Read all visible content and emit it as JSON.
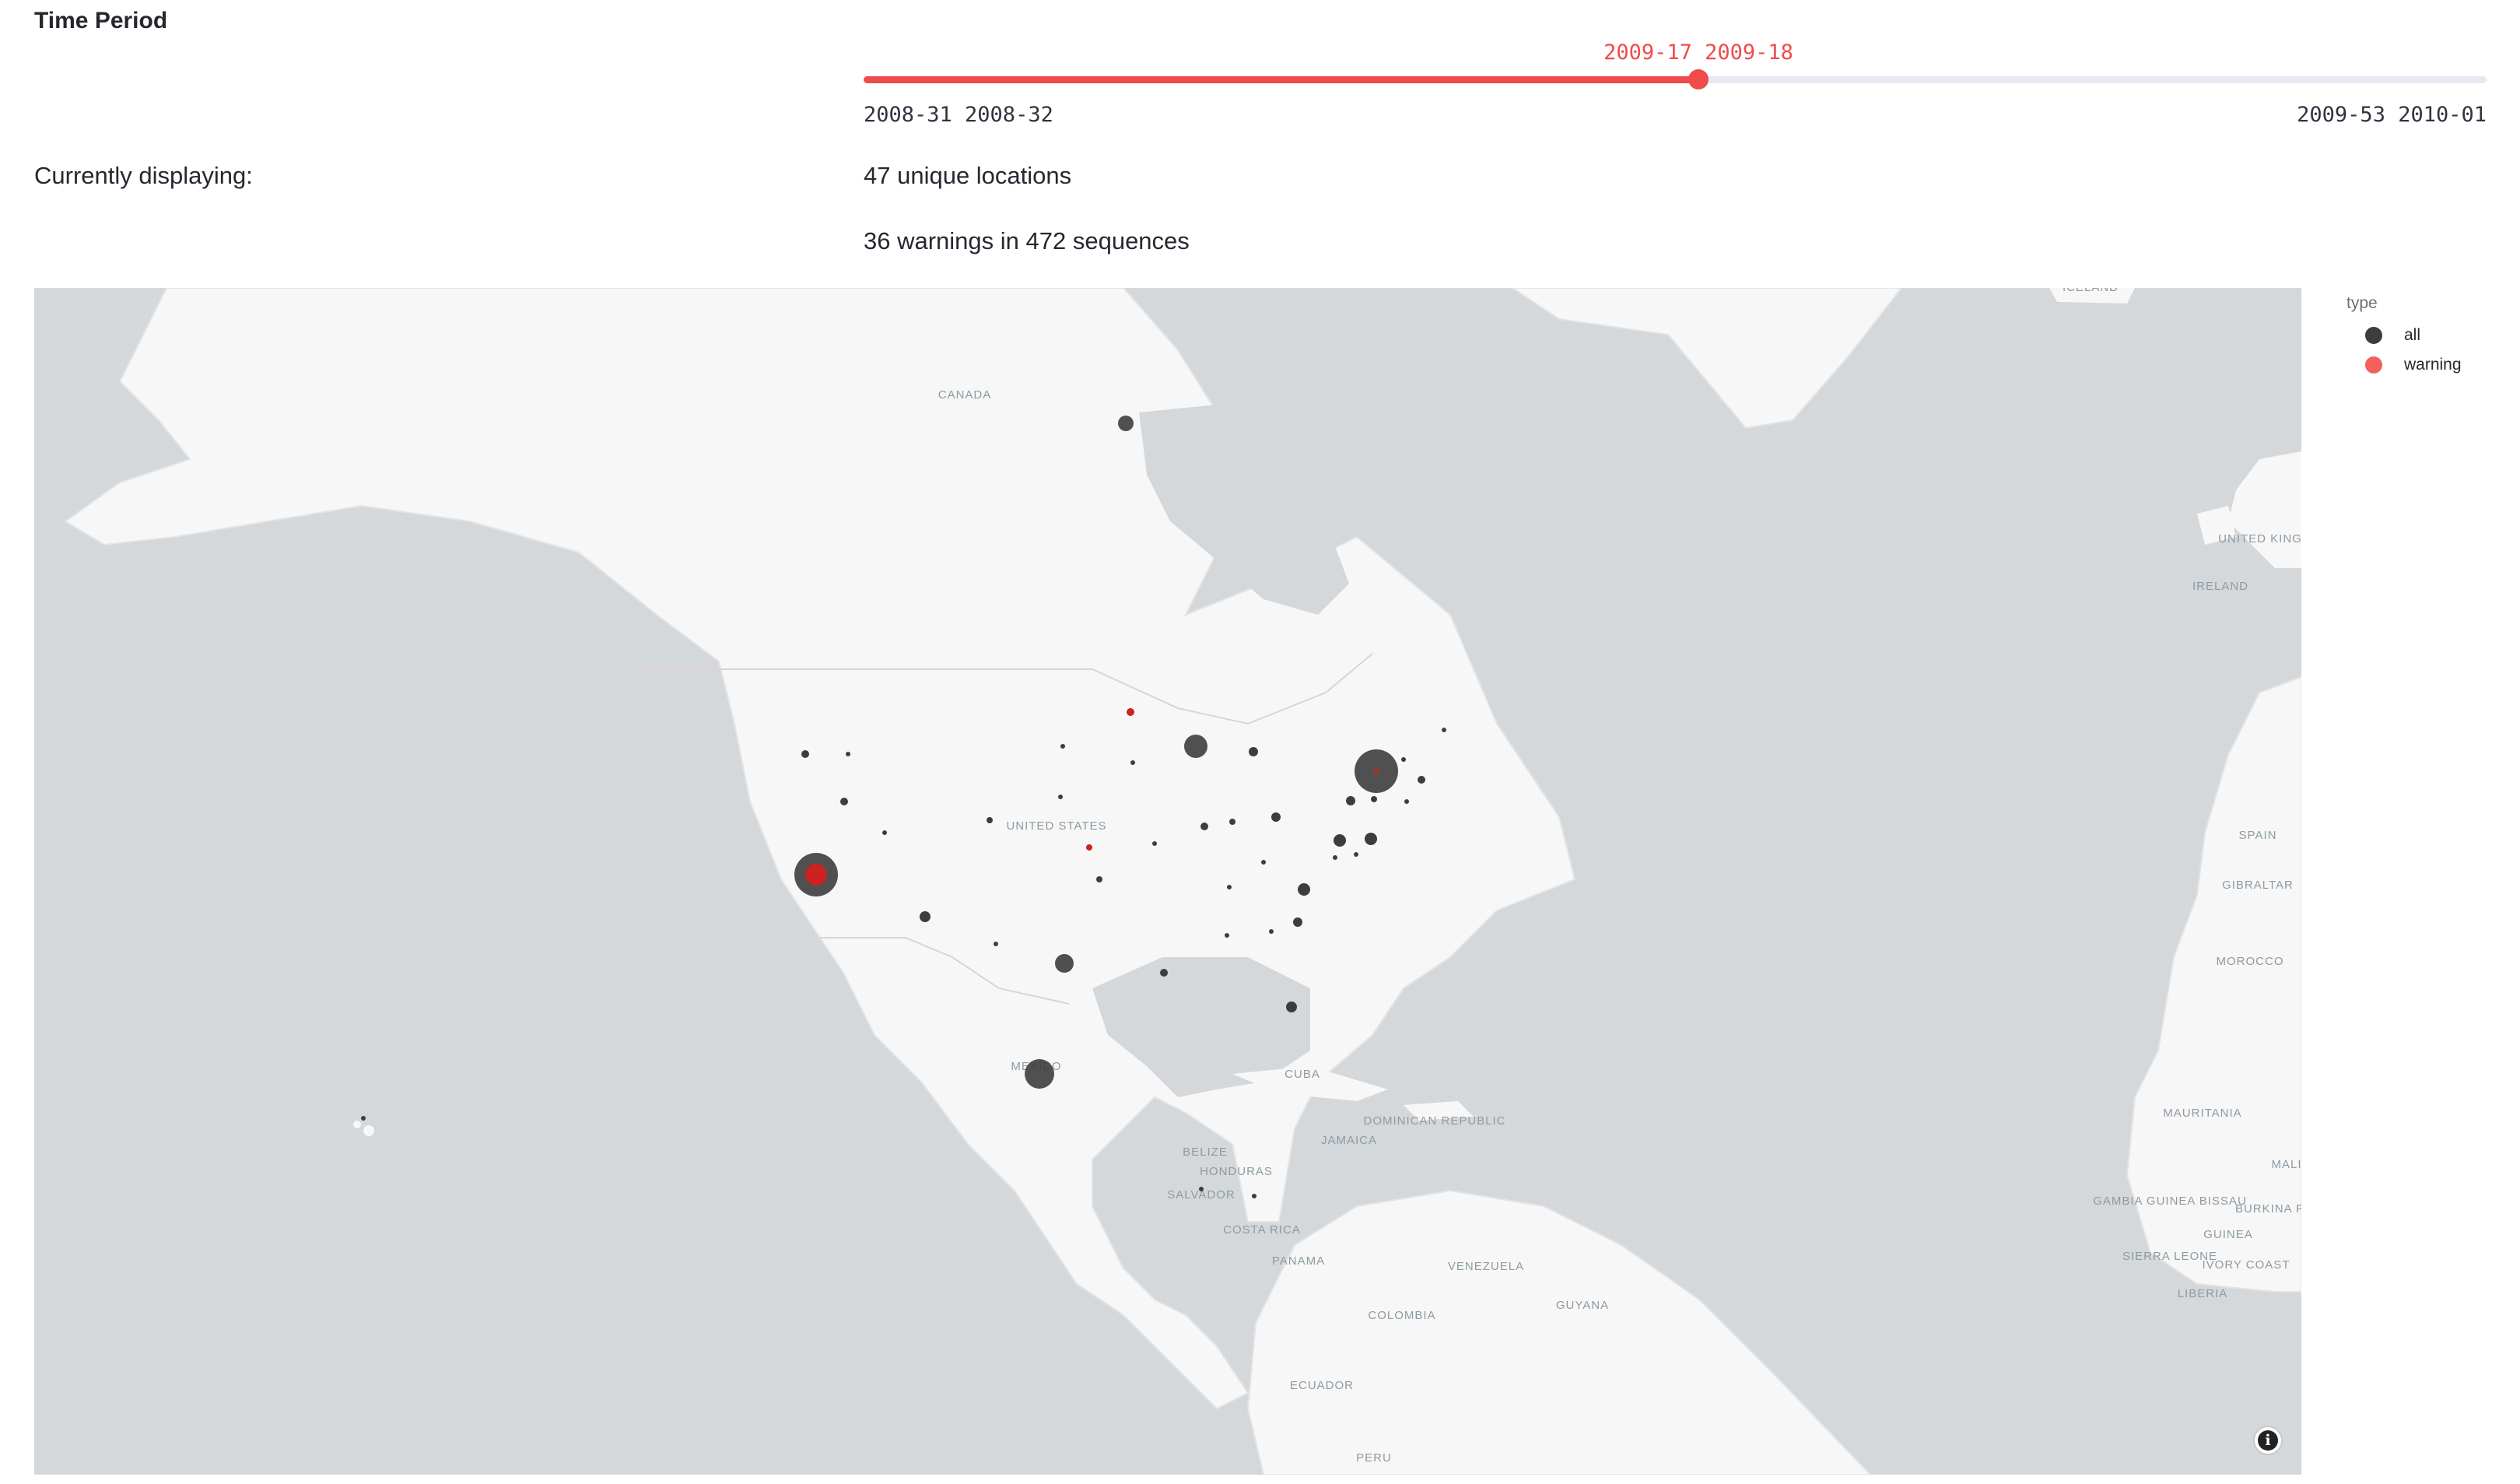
{
  "section_title": "Time Period",
  "slider": {
    "min_label": "2008-31 2008-32",
    "max_label": "2009-53 2010-01",
    "value_label": "2009-17 2009-18",
    "accent_color": "#ef4b4b",
    "track_color": "#e6e9ef"
  },
  "display": {
    "label": "Currently displaying:",
    "locations_text": "47 unique locations",
    "warnings_text": "36 warnings in 472 sequences"
  },
  "legend": {
    "title": "type",
    "items": [
      {
        "label": "all",
        "color": "#3d3d3d"
      },
      {
        "label": "warning",
        "color": "#f4605a"
      }
    ]
  },
  "map": {
    "place_labels": [
      "CANADA",
      "UNITED STATES",
      "MEXICO",
      "CUBA",
      "DOMINICAN REPUBLIC",
      "JAMAICA",
      "BELIZE",
      "HONDURAS",
      "SALVADOR",
      "COSTA RICA",
      "PANAMA",
      "VENEZUELA",
      "COLOMBIA",
      "GUYANA",
      "ECUADOR",
      "PERU",
      "ICELAND",
      "UNITED KINGDOM",
      "IRELAND",
      "SPAIN",
      "GIBRALTAR",
      "MOROCCO",
      "MAURITANIA",
      "MALI",
      "GAMBIA GUINEA BISSAU",
      "GUINEA",
      "BURKINA FASO",
      "SIERRA LEONE",
      "IVORY COAST",
      "LIBERIA"
    ]
  },
  "colors": {
    "ocean": "#d4d8db",
    "land": "#f7f7f7",
    "all": "#3d3d3d",
    "warning": "#f4605a",
    "warning_center": "#cc2222"
  },
  "info_icon": "info-icon"
}
